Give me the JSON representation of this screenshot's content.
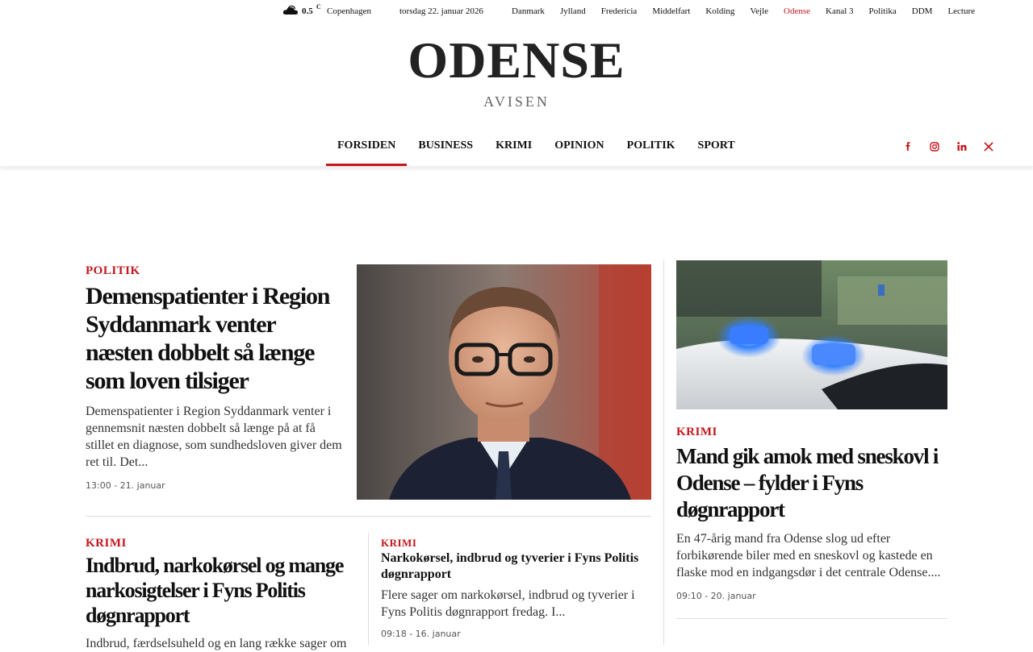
{
  "topbar": {
    "weather_icon": "cloud-icon",
    "temperature": "0.5",
    "temp_unit": "C",
    "city": "Copenhagen",
    "date": "torsdag 22. januar 2026",
    "links": [
      "Danmark",
      "Jylland",
      "Fredericia",
      "Middelfart",
      "Kolding",
      "Vejle",
      "Odense",
      "Kanal 3",
      "Politika",
      "DDM",
      "Lecture"
    ],
    "active_link": "Odense"
  },
  "logo": {
    "main": "ODENSE",
    "sub": "AVISEN"
  },
  "nav": {
    "items": [
      "FORSIDEN",
      "BUSINESS",
      "KRIMI",
      "OPINION",
      "POLITIK",
      "SPORT"
    ],
    "active": "FORSIDEN",
    "social_icons": [
      "facebook-icon",
      "instagram-icon",
      "linkedin-icon",
      "x-icon"
    ]
  },
  "articles": {
    "lead": {
      "category": "POLITIK",
      "title": "Demenspatienter i Region Syddanmark venter næsten dobbelt så længe som loven tilsiger",
      "excerpt": "Demenspatienter i Region Syddanmark venter i gennemsnit næsten dobbelt så længe på at få stillet en diagnose, som sundhedsloven giver dem ret til. Det...",
      "meta": "13:00 - 21. januar"
    },
    "second": {
      "category": "KRIMI",
      "title": "Indbrud, narkokørsel og mange narkosigtelser i Fyns Politis døgnrapport",
      "excerpt": "Indbrud, færdselsuheld og en lang række sager om"
    },
    "third": {
      "category": "KRIMI",
      "title": "Narkokørsel, indbrud og tyverier i Fyns Politis døgnrapport",
      "excerpt": "Flere sager om narkokørsel, indbrud og tyverier i Fyns Politis døgnrapport fredag. I...",
      "meta": "09:18 - 16. januar"
    },
    "side": {
      "category": "KRIMI",
      "title": "Mand gik amok med sneskovl i Odense – fylder i Fyns døgnrapport",
      "excerpt": "En 47-årig mand fra Odense slog ud efter forbikørende biler med en sneskovl og kastede en flaske mod en indgangsdør i det centrale Odense....",
      "meta": "09:10 - 20. januar"
    }
  },
  "colors": {
    "accent": "#c4161c",
    "text": "#111111"
  }
}
